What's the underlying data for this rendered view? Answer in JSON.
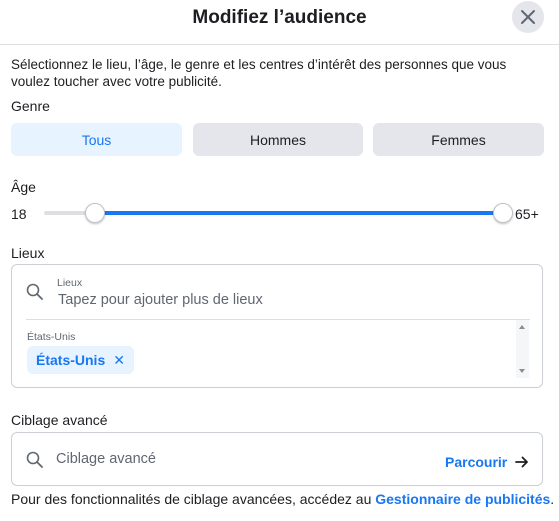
{
  "dialog": {
    "title": "Modifiez l’audience",
    "description": "Sélectionnez le lieu, l’âge, le genre et les centres d’intérêt des personnes que vous voulez toucher avec votre publicité."
  },
  "gender": {
    "label": "Genre",
    "options": [
      "Tous",
      "Hommes",
      "Femmes"
    ],
    "selected": "Tous"
  },
  "age": {
    "label": "Âge",
    "min_label": "18",
    "max_label": "65+",
    "range_min": 18,
    "range_max": 65,
    "selected_min": 18,
    "selected_max": 65
  },
  "locations": {
    "label": "Lieux",
    "search_label": "Lieux",
    "search_placeholder": "Tapez pour ajouter plus de lieux",
    "group_label": "États-Unis",
    "chips": [
      "États-Unis"
    ]
  },
  "advanced": {
    "label": "Ciblage avancé",
    "search_placeholder": "Ciblage avancé",
    "browse_label": "Parcourir"
  },
  "footer": {
    "text": "Pour des fonctionnalités de ciblage avancées, accédez au ",
    "link": "Gestionnaire de publicités",
    "end": "."
  },
  "colors": {
    "accent": "#1877f2",
    "accent_light": "#e7f3ff",
    "button_gray": "#e4e6eb"
  },
  "icons": [
    "close-icon",
    "search-icon",
    "arrow-right-icon",
    "scroll-up-icon",
    "scroll-down-icon"
  ]
}
